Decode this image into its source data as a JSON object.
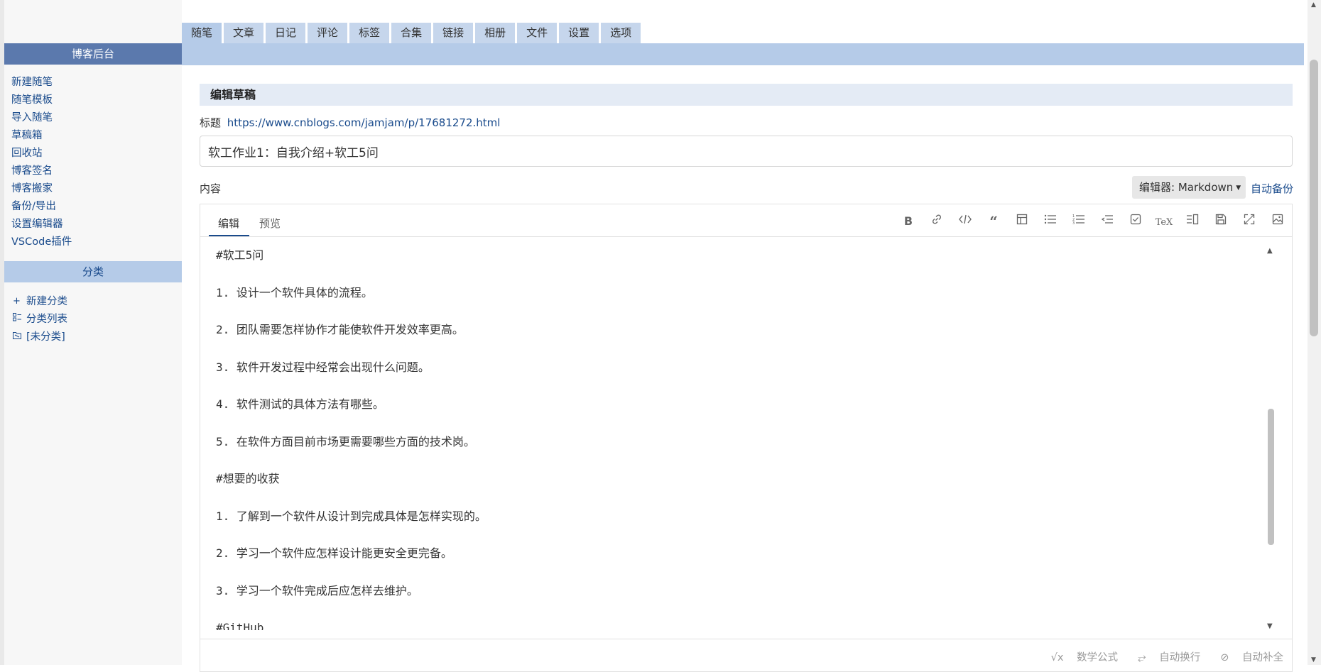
{
  "top_tabs": [
    "随笔",
    "文章",
    "日记",
    "评论",
    "标签",
    "合集",
    "链接",
    "相册",
    "文件",
    "设置",
    "选项"
  ],
  "sidebar": {
    "header": "博客后台",
    "links": [
      "新建随笔",
      "随笔模板",
      "导入随笔",
      "草稿箱",
      "回收站",
      "博客签名",
      "博客搬家",
      "备份/导出",
      "设置编辑器",
      "VSCode插件"
    ],
    "category_header": "分类",
    "categories": [
      {
        "icon": "plus-icon",
        "label": "新建分类"
      },
      {
        "icon": "list-icon",
        "label": "分类列表"
      },
      {
        "icon": "folder-icon",
        "label": "[未分类]"
      }
    ]
  },
  "main": {
    "section_title": "编辑草稿",
    "title_label": "标题",
    "title_link": "https://www.cnblogs.com/jamjam/p/17681272.html",
    "title_value": "软工作业1：自我介绍+软工5问",
    "content_label": "内容",
    "editor_select": "编辑器: Markdown",
    "autobackup": "自动备份"
  },
  "editor": {
    "tab_edit": "编辑",
    "tab_preview": "预览",
    "toolbar_icons": [
      "bold-icon",
      "link-icon",
      "code-icon",
      "quote-icon",
      "table-icon",
      "bullet-list-icon",
      "numbered-list-icon",
      "indent-icon",
      "checkbox-icon",
      "tex-icon",
      "split-view-icon",
      "save-icon",
      "fullscreen-icon",
      "image-icon"
    ],
    "lines": [
      "#软工5问",
      "1. 设计一个软件具体的流程。",
      "2. 团队需要怎样协作才能使软件开发效率更高。",
      "3. 软件开发过程中经常会出现什么问题。",
      "4. 软件测试的具体方法有哪些。",
      "5. 在软件方面目前市场更需要哪些方面的技术岗。",
      "#想要的收获",
      "1. 了解到一个软件从设计到完成具体是怎样实现的。",
      "2. 学习一个软件应怎样设计能更安全更完备。",
      "3. 学习一个软件完成后应怎样去维护。",
      "#GitHub"
    ],
    "status": [
      "数学公式",
      "自动换行",
      "自动补全"
    ]
  }
}
